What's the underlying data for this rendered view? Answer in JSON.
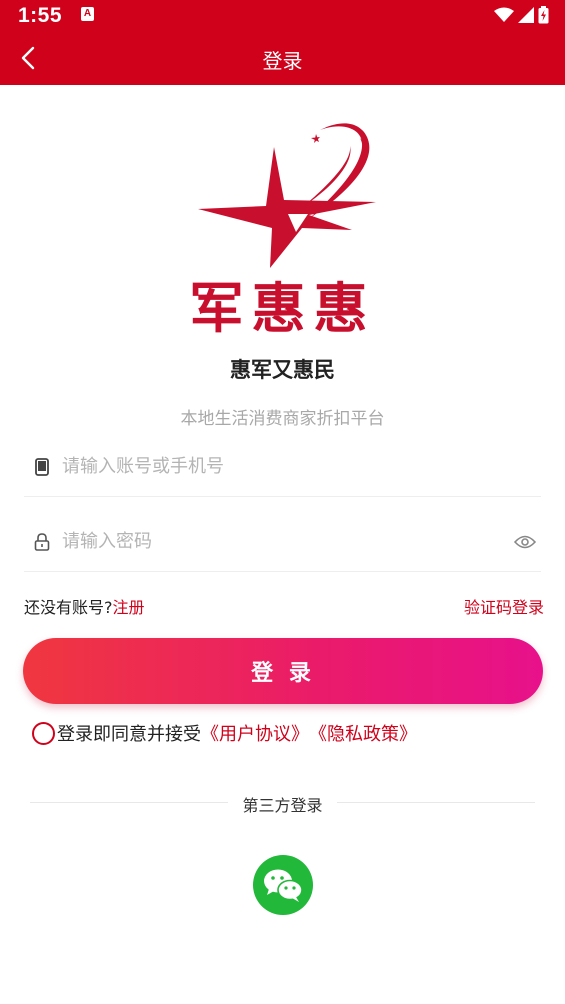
{
  "status_bar": {
    "time": "1:55",
    "notification_icon_letter": "A",
    "icons": [
      "wifi-icon",
      "signal-icon",
      "battery-charging-icon"
    ]
  },
  "header": {
    "title": "登录",
    "back_icon": "chevron-left-icon"
  },
  "brand": {
    "logo_icon": "star-logo-icon",
    "name": "军惠惠",
    "slogan": "惠军又惠民",
    "subtitle": "本地生活消费商家折扣平台"
  },
  "form": {
    "account": {
      "placeholder": "请输入账号或手机号",
      "value": "",
      "icon": "phone-icon"
    },
    "password": {
      "placeholder": "请输入密码",
      "value": "",
      "icon": "lock-icon",
      "toggle_icon": "eye-icon"
    }
  },
  "links": {
    "no_account": "还没有账号?",
    "register": "注册",
    "sms_login": "验证码登录"
  },
  "login_button": "登 录",
  "agreement": {
    "checked": false,
    "text": "登录即同意并接受",
    "user_agreement": "《用户协议》",
    "privacy_policy": "《隐私政策》"
  },
  "third_party": {
    "label": "第三方登录",
    "providers": [
      "wechat-icon"
    ]
  },
  "colors": {
    "primary": "#d0021b",
    "gradient_start": "#f0373f",
    "gradient_end": "#e8118b",
    "wechat": "#22b83a"
  }
}
